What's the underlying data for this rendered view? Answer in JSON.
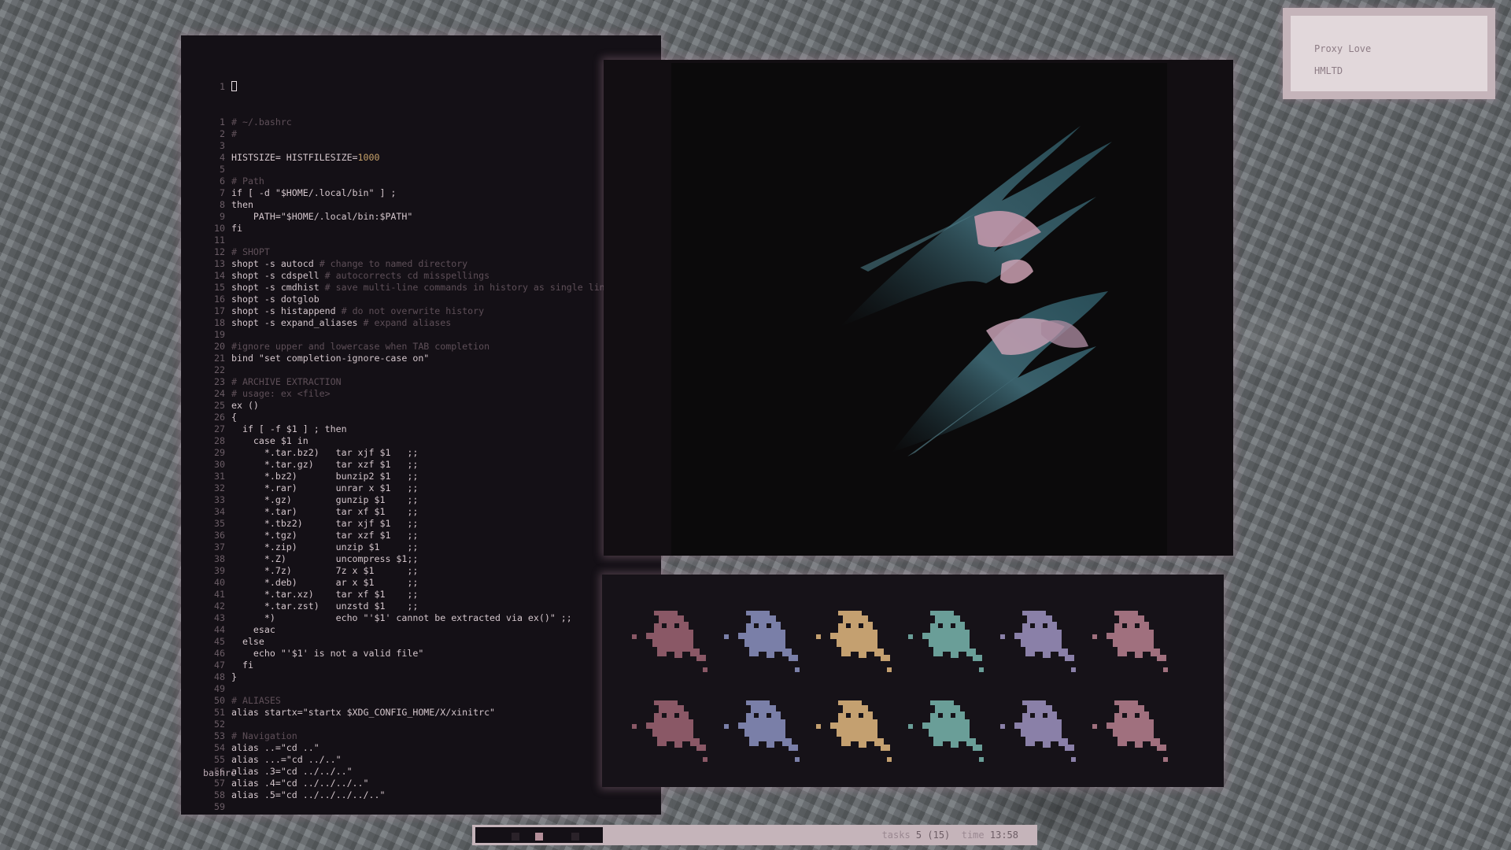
{
  "editor": {
    "cursor_line_number": "1",
    "filename": "bashrc",
    "lines": [
      {
        "n": "1",
        "segs": [
          [
            "cmt",
            "# ~/.bashrc"
          ]
        ]
      },
      {
        "n": "2",
        "segs": [
          [
            "cmt",
            "#"
          ]
        ]
      },
      {
        "n": "3",
        "segs": []
      },
      {
        "n": "4",
        "segs": [
          [
            "kw",
            "HISTSIZE= HISTFILESIZE="
          ],
          [
            "num",
            "1000"
          ]
        ]
      },
      {
        "n": "5",
        "segs": []
      },
      {
        "n": "6",
        "segs": [
          [
            "cmt",
            "# Path"
          ]
        ]
      },
      {
        "n": "7",
        "segs": [
          [
            "kw",
            "if [ -d \"$HOME/.local/bin\" ] ;"
          ]
        ]
      },
      {
        "n": "8",
        "segs": [
          [
            "kw",
            "then"
          ]
        ]
      },
      {
        "n": "9",
        "segs": [
          [
            "kw",
            "    PATH=\"$HOME/.local/bin:$PATH\""
          ]
        ]
      },
      {
        "n": "10",
        "segs": [
          [
            "kw",
            "fi"
          ]
        ]
      },
      {
        "n": "11",
        "segs": []
      },
      {
        "n": "12",
        "segs": [
          [
            "cmt",
            "# SHOPT"
          ]
        ]
      },
      {
        "n": "13",
        "segs": [
          [
            "kw",
            "shopt -s autocd "
          ],
          [
            "cmt",
            "# change to named directory"
          ]
        ]
      },
      {
        "n": "14",
        "segs": [
          [
            "kw",
            "shopt -s cdspell "
          ],
          [
            "cmt",
            "# autocorrects cd misspellings"
          ]
        ]
      },
      {
        "n": "15",
        "segs": [
          [
            "kw",
            "shopt -s cmdhist "
          ],
          [
            "cmt",
            "# save multi-line commands in history as single line"
          ]
        ]
      },
      {
        "n": "16",
        "segs": [
          [
            "kw",
            "shopt -s dotglob"
          ]
        ]
      },
      {
        "n": "17",
        "segs": [
          [
            "kw",
            "shopt -s histappend "
          ],
          [
            "cmt",
            "# do not overwrite history"
          ]
        ]
      },
      {
        "n": "18",
        "segs": [
          [
            "kw",
            "shopt -s expand_aliases "
          ],
          [
            "cmt",
            "# expand aliases"
          ]
        ]
      },
      {
        "n": "19",
        "segs": []
      },
      {
        "n": "20",
        "segs": [
          [
            "cmt",
            "#ignore upper and lowercase when TAB completion"
          ]
        ]
      },
      {
        "n": "21",
        "segs": [
          [
            "kw",
            "bind \"set completion-ignore-case on\""
          ]
        ]
      },
      {
        "n": "22",
        "segs": []
      },
      {
        "n": "23",
        "segs": [
          [
            "cmt",
            "# ARCHIVE EXTRACTION"
          ]
        ]
      },
      {
        "n": "24",
        "segs": [
          [
            "cmt",
            "# usage: ex <file>"
          ]
        ]
      },
      {
        "n": "25",
        "segs": [
          [
            "kw",
            "ex ()"
          ]
        ]
      },
      {
        "n": "26",
        "segs": [
          [
            "kw",
            "{"
          ]
        ]
      },
      {
        "n": "27",
        "segs": [
          [
            "kw",
            "  if [ -f $1 ] ; then"
          ]
        ]
      },
      {
        "n": "28",
        "segs": [
          [
            "kw",
            "    case $1 in"
          ]
        ]
      },
      {
        "n": "29",
        "segs": [
          [
            "kw",
            "      *.tar.bz2)   tar xjf $1   ;;"
          ]
        ]
      },
      {
        "n": "30",
        "segs": [
          [
            "kw",
            "      *.tar.gz)    tar xzf $1   ;;"
          ]
        ]
      },
      {
        "n": "31",
        "segs": [
          [
            "kw",
            "      *.bz2)       bunzip2 $1   ;;"
          ]
        ]
      },
      {
        "n": "32",
        "segs": [
          [
            "kw",
            "      *.rar)       unrar x $1   ;;"
          ]
        ]
      },
      {
        "n": "33",
        "segs": [
          [
            "kw",
            "      *.gz)        gunzip $1    ;;"
          ]
        ]
      },
      {
        "n": "34",
        "segs": [
          [
            "kw",
            "      *.tar)       tar xf $1    ;;"
          ]
        ]
      },
      {
        "n": "35",
        "segs": [
          [
            "kw",
            "      *.tbz2)      tar xjf $1   ;;"
          ]
        ]
      },
      {
        "n": "36",
        "segs": [
          [
            "kw",
            "      *.tgz)       tar xzf $1   ;;"
          ]
        ]
      },
      {
        "n": "37",
        "segs": [
          [
            "kw",
            "      *.zip)       unzip $1     ;;"
          ]
        ]
      },
      {
        "n": "38",
        "segs": [
          [
            "kw",
            "      *.Z)         uncompress $1;;"
          ]
        ]
      },
      {
        "n": "39",
        "segs": [
          [
            "kw",
            "      *.7z)        7z x $1      ;;"
          ]
        ]
      },
      {
        "n": "40",
        "segs": [
          [
            "kw",
            "      *.deb)       ar x $1      ;;"
          ]
        ]
      },
      {
        "n": "41",
        "segs": [
          [
            "kw",
            "      *.tar.xz)    tar xf $1    ;;"
          ]
        ]
      },
      {
        "n": "42",
        "segs": [
          [
            "kw",
            "      *.tar.zst)   unzstd $1    ;;"
          ]
        ]
      },
      {
        "n": "43",
        "segs": [
          [
            "kw",
            "      *)           echo \"'$1' cannot be extracted via ex()\" ;;"
          ]
        ]
      },
      {
        "n": "44",
        "segs": [
          [
            "kw",
            "    esac"
          ]
        ]
      },
      {
        "n": "45",
        "segs": [
          [
            "kw",
            "  else"
          ]
        ]
      },
      {
        "n": "46",
        "segs": [
          [
            "kw",
            "    echo \"'$1' is not a valid file\""
          ]
        ]
      },
      {
        "n": "47",
        "segs": [
          [
            "kw",
            "  fi"
          ]
        ]
      },
      {
        "n": "48",
        "segs": [
          [
            "kw",
            "}"
          ]
        ]
      },
      {
        "n": "49",
        "segs": []
      },
      {
        "n": "50",
        "segs": [
          [
            "cmt",
            "# ALIASES"
          ]
        ]
      },
      {
        "n": "51",
        "segs": [
          [
            "kw",
            "alias startx=\"startx $XDG_CONFIG_HOME/X/xinitrc\""
          ]
        ]
      },
      {
        "n": "52",
        "segs": []
      },
      {
        "n": "53",
        "segs": [
          [
            "cmt",
            "# Navigation"
          ]
        ]
      },
      {
        "n": "54",
        "segs": [
          [
            "kw",
            "alias ..=\"cd ..\""
          ]
        ]
      },
      {
        "n": "55",
        "segs": [
          [
            "kw",
            "alias ...=\"cd ../..\""
          ]
        ]
      },
      {
        "n": "56",
        "segs": [
          [
            "kw",
            "alias .3=\"cd ../../..\""
          ]
        ]
      },
      {
        "n": "57",
        "segs": [
          [
            "kw",
            "alias .4=\"cd ../../../..\""
          ]
        ]
      },
      {
        "n": "58",
        "segs": [
          [
            "kw",
            "alias .5=\"cd ../../../../..\""
          ]
        ]
      },
      {
        "n": "59",
        "segs": []
      }
    ]
  },
  "music": {
    "track": "Proxy Love",
    "artist": "HMLTD"
  },
  "ghosts": {
    "colors": [
      "#8a5866",
      "#7a7fa8",
      "#c4a070",
      "#6a9e98",
      "#8a80a8",
      "#a0707e"
    ],
    "rows": 2
  },
  "bar": {
    "tags_label": "tasks",
    "tasks_value": "5 (15)",
    "time_label": "time",
    "time_value": "13:58",
    "tag_colors": [
      "#2a2229",
      "#b48f99",
      "#2a2229"
    ]
  },
  "colors": {
    "accent": "#c5b4ba",
    "background": "#141016"
  }
}
